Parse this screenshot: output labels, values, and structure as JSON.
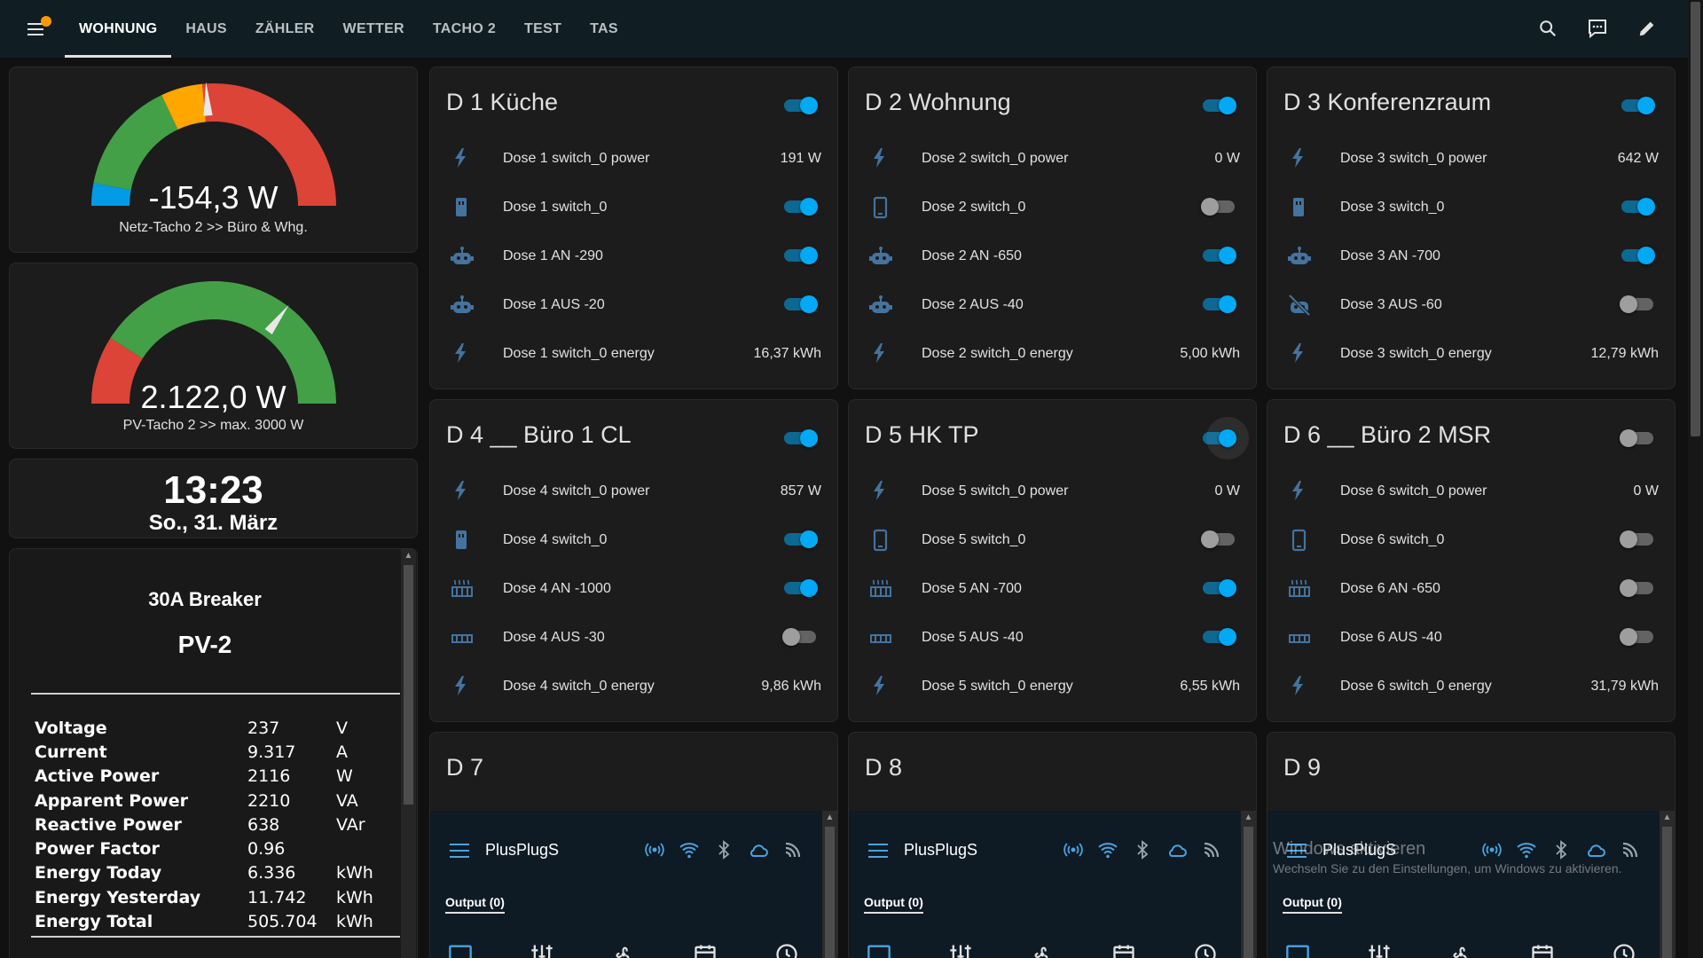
{
  "topbar": {
    "tabs": [
      {
        "label": "WOHNUNG",
        "active": true
      },
      {
        "label": "HAUS"
      },
      {
        "label": "ZÄHLER"
      },
      {
        "label": "WETTER"
      },
      {
        "label": "TACHO 2"
      },
      {
        "label": "TEST"
      },
      {
        "label": "TAS"
      }
    ],
    "icons": [
      "search-icon",
      "assist-icon",
      "edit-icon"
    ],
    "notification_color": "#ff9800"
  },
  "gauges": [
    {
      "value": "-154,3 W",
      "label": "Netz-Tacho 2 >> Büro & Whg.",
      "needle_fraction": 0.48
    },
    {
      "value": "2.122,0 W",
      "label": "PV-Tacho 2 >> max. 3000 W",
      "needle_fraction": 0.707
    }
  ],
  "clock": {
    "time": "13:23",
    "date": "So., 31. März"
  },
  "breaker": {
    "title": "30A Breaker",
    "subtitle": "PV-2",
    "rows": [
      {
        "label": "Voltage",
        "value": "237",
        "unit": "V"
      },
      {
        "label": "Current",
        "value": "9.317",
        "unit": "A"
      },
      {
        "label": "Active Power",
        "value": "2116",
        "unit": "W"
      },
      {
        "label": "Apparent Power",
        "value": "2210",
        "unit": "VA"
      },
      {
        "label": "Reactive Power",
        "value": "638",
        "unit": "VAr"
      },
      {
        "label": "Power Factor",
        "value": "0.96",
        "unit": ""
      },
      {
        "label": "Energy Today",
        "value": "6.336",
        "unit": "kWh"
      },
      {
        "label": "Energy Yesterday",
        "value": "11.742",
        "unit": "kWh"
      },
      {
        "label": "Energy Total",
        "value": "505.704",
        "unit": "kWh"
      }
    ]
  },
  "cards": [
    {
      "title": "D 1 Küche",
      "on": true,
      "rows": [
        {
          "icon": "flash-icon",
          "name": "Dose 1 switch_0 power",
          "state": "191 W"
        },
        {
          "icon": "power-socket-icon",
          "name": "Dose 1 switch_0",
          "toggle": true
        },
        {
          "icon": "robot-icon",
          "name": "Dose 1 AN -290",
          "toggle": true
        },
        {
          "icon": "robot-icon",
          "name": "Dose 1 AUS -20",
          "toggle": true
        },
        {
          "icon": "flash-icon",
          "name": "Dose 1 switch_0 energy",
          "state": "16,37 kWh"
        }
      ]
    },
    {
      "title": "D 2 Wohnung",
      "on": true,
      "rows": [
        {
          "icon": "flash-icon",
          "name": "Dose 2 switch_0 power",
          "state": "0 W"
        },
        {
          "icon": "cellphone-icon",
          "name": "Dose 2 switch_0",
          "toggle": false
        },
        {
          "icon": "robot-icon",
          "name": "Dose 2 AN -650",
          "toggle": true
        },
        {
          "icon": "robot-icon",
          "name": "Dose 2 AUS -40",
          "toggle": true
        },
        {
          "icon": "flash-icon",
          "name": "Dose 2 switch_0 energy",
          "state": "5,00 kWh"
        }
      ]
    },
    {
      "title": "D 3 Konferenzraum",
      "on": true,
      "rows": [
        {
          "icon": "flash-icon",
          "name": "Dose 3 switch_0 power",
          "state": "642 W"
        },
        {
          "icon": "power-socket-icon",
          "name": "Dose 3 switch_0",
          "toggle": true
        },
        {
          "icon": "robot-icon",
          "name": "Dose 3 AN -700",
          "toggle": true
        },
        {
          "icon": "robot-off-icon",
          "name": "Dose 3 AUS -60",
          "toggle": false
        },
        {
          "icon": "flash-icon",
          "name": "Dose 3 switch_0 energy",
          "state": "12,79 kWh"
        }
      ]
    },
    {
      "title": "D 4 __ Büro 1 CL",
      "on": true,
      "rows": [
        {
          "icon": "flash-icon",
          "name": "Dose 4 switch_0 power",
          "state": "857 W"
        },
        {
          "icon": "power-socket-icon",
          "name": "Dose 4 switch_0",
          "toggle": true
        },
        {
          "icon": "radiator-icon",
          "name": "Dose 4 AN -1000",
          "toggle": true
        },
        {
          "icon": "radiator-off-icon",
          "name": "Dose 4 AUS -30",
          "toggle": false
        },
        {
          "icon": "flash-icon",
          "name": "Dose 4 switch_0 energy",
          "state": "9,86 kWh"
        }
      ]
    },
    {
      "title": "D 5 HK TP",
      "on": true,
      "focus": true,
      "rows": [
        {
          "icon": "flash-icon",
          "name": "Dose 5 switch_0 power",
          "state": "0 W"
        },
        {
          "icon": "cellphone-icon",
          "name": "Dose 5 switch_0",
          "toggle": false
        },
        {
          "icon": "radiator-icon",
          "name": "Dose 5 AN -700",
          "toggle": true
        },
        {
          "icon": "radiator-off-icon",
          "name": "Dose 5 AUS -40",
          "toggle": true
        },
        {
          "icon": "flash-icon",
          "name": "Dose 5 switch_0 energy",
          "state": "6,55 kWh"
        }
      ]
    },
    {
      "title": "D 6 __ Büro 2 MSR",
      "on": false,
      "rows": [
        {
          "icon": "flash-icon",
          "name": "Dose 6 switch_0 power",
          "state": "0 W"
        },
        {
          "icon": "cellphone-icon",
          "name": "Dose 6 switch_0",
          "toggle": false
        },
        {
          "icon": "radiator-icon",
          "name": "Dose 6 AN -650",
          "toggle": false
        },
        {
          "icon": "radiator-off-icon",
          "name": "Dose 6 AUS -40",
          "toggle": false
        },
        {
          "icon": "flash-icon",
          "name": "Dose 6 switch_0 energy",
          "state": "31,79 kWh"
        }
      ]
    }
  ],
  "devices": [
    {
      "title": "D 7",
      "name": "PlusPlugS",
      "output": "Output (0)"
    },
    {
      "title": "D 8",
      "name": "PlusPlugS",
      "output": "Output (0)"
    },
    {
      "title": "D 9",
      "name": "PlusPlugS",
      "output": "Output (0)"
    }
  ],
  "device_status_icons": [
    "broadcast-icon",
    "wifi-icon",
    "bluetooth-icon",
    "cloud-icon",
    "rss-icon"
  ],
  "device_bottom_icons": [
    "monitor-icon",
    "sliders-icon",
    "fan-icon",
    "calendar-icon",
    "clock-icon"
  ],
  "watermark": {
    "title": "Windows aktivieren",
    "subtitle": "Wechseln Sie zu den Einstellungen, um Windows zu aktivieren."
  },
  "colors": {
    "accent": "#03a9f4",
    "icon": "#44739e",
    "gauge_green": "#43a047",
    "gauge_red": "#db4437",
    "gauge_orange": "#ffa600",
    "gauge_blue": "#039be5"
  }
}
